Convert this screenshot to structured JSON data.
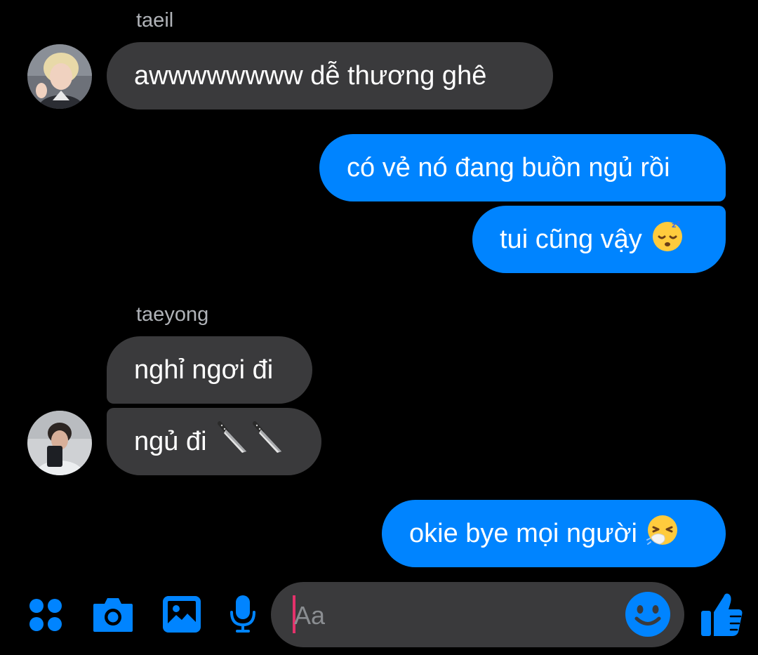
{
  "conversation": {
    "groups": [
      {
        "sender": "taeil",
        "messages": [
          {
            "text": "awwwwwwww dễ thương ghê"
          }
        ]
      },
      {
        "sender": "me",
        "messages": [
          {
            "text": "có vẻ nó đang buồn ngủ rồi"
          },
          {
            "text": "tui cũng vậy",
            "emoji": "sleeping-face"
          }
        ]
      },
      {
        "sender": "taeyong",
        "messages": [
          {
            "text": "nghỉ ngơi đi"
          },
          {
            "text": "ngủ đi",
            "emoji": "knife-knife"
          }
        ]
      },
      {
        "sender": "me",
        "messages": [
          {
            "text": "okie bye mọi người",
            "emoji": "sneezing-face"
          }
        ]
      }
    ]
  },
  "composer": {
    "placeholder": "Aa",
    "icons": [
      "menu-dots-icon",
      "camera-icon",
      "gallery-icon",
      "microphone-icon",
      "emoji-icon",
      "thumbs-up-icon"
    ]
  },
  "colors": {
    "background": "#000000",
    "incoming_bubble": "#3a3a3c",
    "outgoing_bubble": "#0084ff",
    "accent": "#0084ff",
    "caret": "#e4316b",
    "sender_name": "#b0b3b8"
  }
}
